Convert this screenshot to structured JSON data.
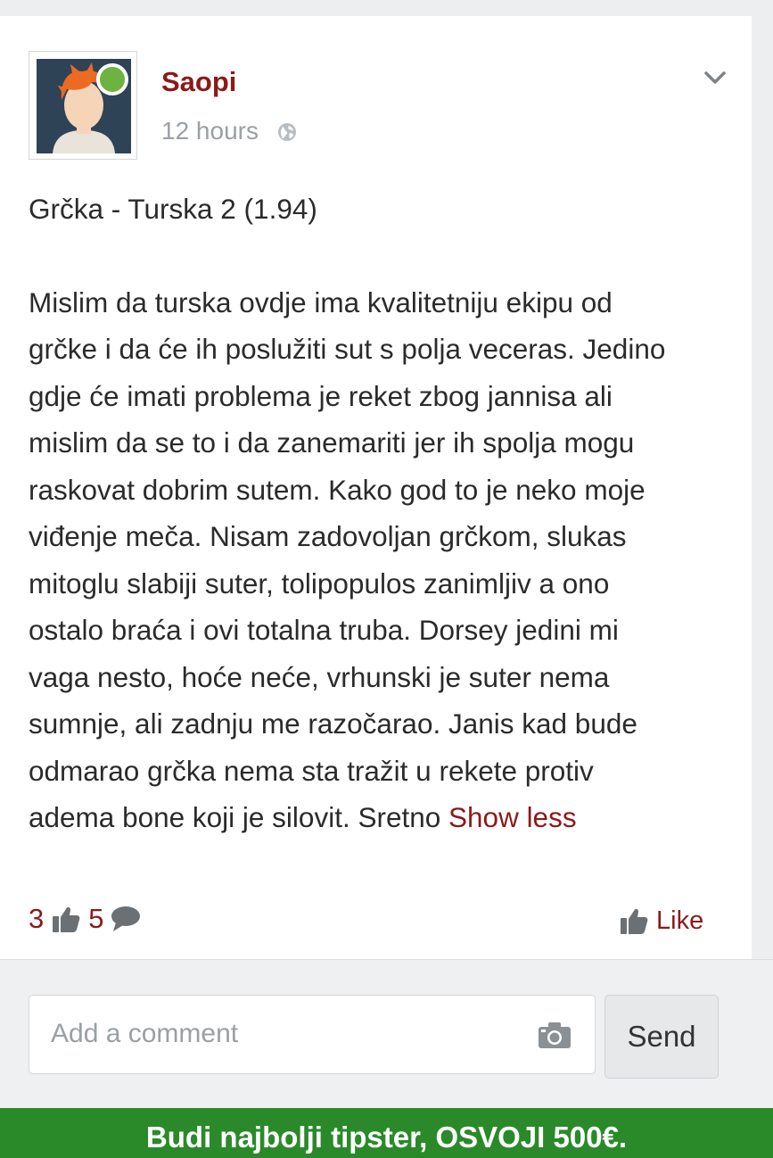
{
  "post": {
    "author": "Saopi",
    "time": "12 hours",
    "title": "Grčka - Turska 2 (1.94)",
    "body": "Mislim da turska ovdje ima kvalitetniju ekipu od\ngrčke i da će ih poslužiti sut s polja veceras. Jedino\ngdje će imati problema je reket zbog jannisa ali\nmislim da se to i da zanemariti jer ih spolja mogu\nraskovat dobrim sutem. Kako god to je neko moje\nviđenje meča. Nisam zadovoljan grčkom, slukas\nmitoglu slabiji suter, tolipopulos zanimljiv a ono\nostalo braća i ovi totalna truba. Dorsey jedini mi\nvaga nesto, hoće neće, vrhunski je suter nema\nsumnje, ali zadnju me razočarao. Janis kad bude\nodmarao grčka nema sta tražit u rekete protiv\nadema bone koji je silovit. Sretno ",
    "show_less": "Show less",
    "likes_count": "3",
    "comments_count": "5",
    "like_label": "Like",
    "icons": {
      "avatar": "user-avatar",
      "online": "online-status-icon",
      "privacy": "globe-icon",
      "menu": "chevron-down-icon",
      "likes": "thumbs-up-icon",
      "comments": "speech-bubble-icon",
      "like_button": "thumbs-up-icon"
    }
  },
  "comment_box": {
    "placeholder": "Add a comment",
    "send_label": "Send",
    "camera_icon": "camera-icon"
  },
  "banner": {
    "text": "Budi najbolji tipster, OSVOJI 500€."
  },
  "colors": {
    "accent": "#8b1a1a",
    "online": "#6cb33f",
    "banner": "#2a8a2a",
    "muted": "#9aa0a4"
  }
}
